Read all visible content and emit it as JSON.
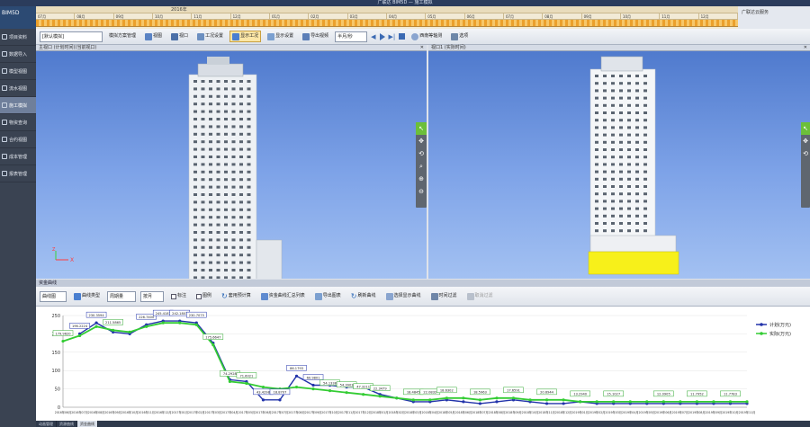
{
  "window": {
    "title": "广联达 BIM5D — 施工模拟"
  },
  "logo": {
    "text": "BIM5D"
  },
  "timeline": {
    "year": "2016年",
    "months": [
      "07月",
      "08月",
      "09月",
      "10月",
      "11月",
      "12月",
      "01月",
      "02月",
      "03月",
      "04月",
      "05月",
      "06月",
      "07月",
      "08月",
      "09月",
      "10月",
      "11月",
      "12月"
    ],
    "right_text": "广联达云服务"
  },
  "toolbar": {
    "mode_select": "[默认模拟]",
    "btn_manage": "模拟方案管理",
    "btn_view": "视图",
    "btn_viewport": "视口",
    "btn_work_settings": "工况设置",
    "btn_show_work": "显示工况",
    "btn_display_settings": "显示设置",
    "btn_export_video": "导出视频",
    "speed_select": "半月/秒",
    "btn_view_angle": "西南等轴测",
    "btn_option": "选项"
  },
  "sidebar": {
    "items": [
      {
        "label": "项目资料"
      },
      {
        "label": "数据导入"
      },
      {
        "label": "模型视图"
      },
      {
        "label": "流水视图"
      },
      {
        "label": "施工模拟"
      },
      {
        "label": "物资查询"
      },
      {
        "label": "合约视图"
      },
      {
        "label": "成本管理"
      },
      {
        "label": "报表管理"
      }
    ]
  },
  "viewport_left": {
    "title": "主视口 (计划时间)(当前视口)"
  },
  "viewport_right": {
    "title": "视口1 (实际时间)"
  },
  "floatbar": {
    "icons": [
      "cursor-icon",
      "pan-icon",
      "rotate-icon",
      "zoom-icon",
      "zoom-in-icon",
      "zoom-out-icon"
    ]
  },
  "resource_panel": {
    "title": "资金曲线"
  },
  "resource_toolbar": {
    "btn_curve_view": "曲线图",
    "btn_curve_type": "曲线类型",
    "period_select": "周期量",
    "unit_select": "按月",
    "chk_label": "标注",
    "chk_legend": "图例",
    "btn_apply_plan": "套用预计算",
    "btn_fund_summary": "资金曲线汇总列表",
    "btn_export_image": "导出图表",
    "btn_refresh": "刷新曲线",
    "btn_select_curve": "选择显示曲线",
    "btn_time_filter": "时间过滤",
    "btn_cancel_filter": "取消过滤"
  },
  "bottom_tabs": [
    "动画管理",
    "资源曲线",
    "资金曲线"
  ],
  "colors": {
    "plan": "#2233aa",
    "actual": "#33cc33",
    "timeline": "#eba02c",
    "sidebar": "#3a4352"
  },
  "chart_data": {
    "type": "line",
    "title": "",
    "ylim": [
      0,
      250
    ],
    "yticks": [
      0,
      50,
      100,
      150,
      200,
      250
    ],
    "x": [
      "2016年06月",
      "2016年07月",
      "2016年08月",
      "2016年09月",
      "2016年10月",
      "2016年11月",
      "2016年12月",
      "2017年01月",
      "2017年02月",
      "2017年03月",
      "2017年04月",
      "2017年05月",
      "2017年06月",
      "2017年07月",
      "2017年08月",
      "2017年09月",
      "2017年10月",
      "2017年11月",
      "2017年12月",
      "2018年01月",
      "2018年02月",
      "2018年03月",
      "2018年04月",
      "2018年05月",
      "2018年06月",
      "2018年07月",
      "2018年08月",
      "2018年09月",
      "2018年10月",
      "2018年11月",
      "2018年12月",
      "2019年01月",
      "2019年02月",
      "2019年03月",
      "2019年04月",
      "2019年05月",
      "2019年06月",
      "2019年07月",
      "2019年08月",
      "2019年09月",
      "2019年10月",
      "2019年11月"
    ],
    "legend": {
      "position": "right",
      "entries": [
        "计划(万元)",
        "实际(万元)"
      ]
    },
    "series": [
      {
        "name": "计划(万元)",
        "values": [
          null,
          200,
          230,
          205,
          200,
          225,
          235,
          235,
          230,
          175,
          75,
          70,
          20,
          20,
          85,
          60,
          60,
          55,
          55,
          35,
          25,
          15,
          15,
          20,
          15,
          10,
          15,
          20,
          15,
          10,
          10,
          15,
          10,
          10,
          10,
          10,
          10,
          10,
          10,
          10,
          10,
          10
        ]
      },
      {
        "name": "实际(万元)",
        "values": [
          180,
          195,
          220,
          210,
          205,
          220,
          230,
          230,
          225,
          170,
          70,
          65,
          55,
          50,
          55,
          50,
          45,
          40,
          35,
          30,
          25,
          20,
          20,
          25,
          25,
          20,
          25,
          25,
          20,
          20,
          20,
          15,
          15,
          15,
          15,
          15,
          15,
          15,
          15,
          15,
          15,
          15
        ]
      }
    ],
    "data_labels": [
      {
        "series": 1,
        "index": 0,
        "text": "179.9620"
      },
      {
        "series": 0,
        "index": 1,
        "text": "196.2224"
      },
      {
        "series": 0,
        "index": 2,
        "text": "230.3594"
      },
      {
        "series": 1,
        "index": 3,
        "text": "211.5865"
      },
      {
        "series": 0,
        "index": 5,
        "text": "226.7400"
      },
      {
        "series": 0,
        "index": 6,
        "text": "245.4187"
      },
      {
        "series": 0,
        "index": 7,
        "text": "242.1803"
      },
      {
        "series": 0,
        "index": 8,
        "text": "230.7075"
      },
      {
        "series": 1,
        "index": 9,
        "text": "175.6647"
      },
      {
        "series": 1,
        "index": 10,
        "text": "74.2928"
      },
      {
        "series": 1,
        "index": 11,
        "text": "71.6021"
      },
      {
        "series": 0,
        "index": 12,
        "text": "43.4298"
      },
      {
        "series": 0,
        "index": 13,
        "text": "18.8707"
      },
      {
        "series": 0,
        "index": 14,
        "text": "86.1793"
      },
      {
        "series": 0,
        "index": 15,
        "text": "60.9801"
      },
      {
        "series": 1,
        "index": 16,
        "text": "54.1338"
      },
      {
        "series": 1,
        "index": 17,
        "text": "54.3903"
      },
      {
        "series": 1,
        "index": 18,
        "text": "47.3211"
      },
      {
        "series": 1,
        "index": 19,
        "text": "22.3479"
      },
      {
        "series": 1,
        "index": 21,
        "text": "18.4845"
      },
      {
        "series": 1,
        "index": 22,
        "text": "22.0832"
      },
      {
        "series": 1,
        "index": 23,
        "text": "18.6302"
      },
      {
        "series": 1,
        "index": 25,
        "text": "18.5963"
      },
      {
        "series": 1,
        "index": 27,
        "text": "17.6591"
      },
      {
        "series": 1,
        "index": 29,
        "text": "20.6944"
      },
      {
        "series": 1,
        "index": 31,
        "text": "13.2940"
      },
      {
        "series": 1,
        "index": 33,
        "text": "15.1027"
      },
      {
        "series": 1,
        "index": 36,
        "text": "12.0905"
      },
      {
        "series": 1,
        "index": 38,
        "text": "11.7952"
      },
      {
        "series": 1,
        "index": 40,
        "text": "11.7783"
      }
    ]
  }
}
